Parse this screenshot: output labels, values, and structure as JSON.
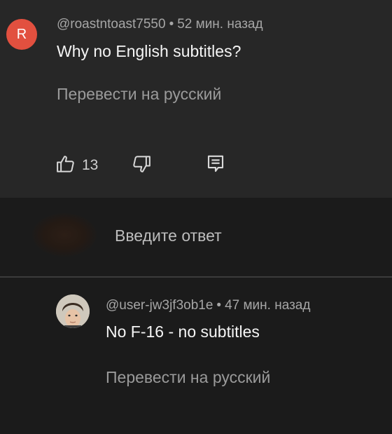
{
  "comment": {
    "avatar_letter": "R",
    "avatar_color": "#e2503f",
    "author": "@roastntoast7550",
    "separator": "•",
    "time": "52 мин. назад",
    "text": "Why no English subtitles?",
    "translate_label": "Перевести на русский",
    "like_count": "13",
    "icons": {
      "like": "thumbs-up-icon",
      "dislike": "thumbs-down-icon",
      "reply": "comment-reply-icon"
    }
  },
  "reply_box": {
    "placeholder": "Введите ответ"
  },
  "reply": {
    "author": "@user-jw3jf3ob1e",
    "separator": "•",
    "time": "47 мин. назад",
    "text": "No F-16 - no subtitles",
    "translate_label": "Перевести на русский"
  },
  "colors": {
    "panel_bg": "#272727",
    "page_bg": "#1b1b1b",
    "meta_text": "#a6a6a6",
    "translate_text": "#9a9a9a"
  }
}
